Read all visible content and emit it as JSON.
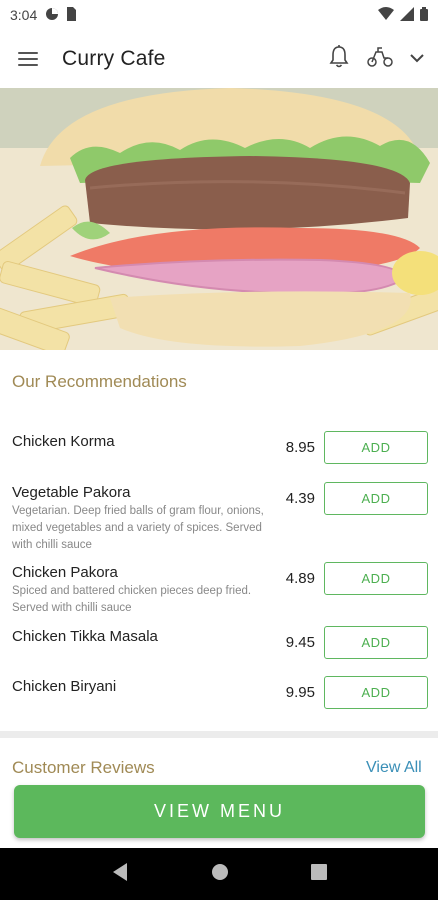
{
  "status": {
    "time": "3:04"
  },
  "app": {
    "title": "Curry Cafe"
  },
  "recommendations": {
    "title": "Our Recommendations",
    "items": [
      {
        "name": "Chicken Korma",
        "desc": "",
        "price": "8.95",
        "button": "ADD"
      },
      {
        "name": "Vegetable Pakora",
        "desc": "Vegetarian. Deep fried balls of gram flour, onions, mixed vegetables and a variety of spices. Served with chilli sauce",
        "price": "4.39",
        "button": "ADD"
      },
      {
        "name": "Chicken Pakora",
        "desc": "Spiced and battered chicken pieces deep fried. Served with chilli sauce",
        "price": "4.89",
        "button": "ADD"
      },
      {
        "name": "Chicken Tikka Masala",
        "desc": "",
        "price": "9.45",
        "button": "ADD"
      },
      {
        "name": "Chicken Biryani",
        "desc": "",
        "price": "9.95",
        "button": "ADD"
      }
    ]
  },
  "reviews": {
    "title": "Customer Reviews",
    "view_all": "View All"
  },
  "cta": {
    "label": "VIEW MENU"
  },
  "colors": {
    "accent_green": "#5cb85c",
    "section_gold": "#a08a55",
    "link_blue": "#3a8fb7"
  },
  "icons": [
    "menu-icon",
    "bell-icon",
    "scooter-icon",
    "chevron-down-icon",
    "back-icon",
    "home-icon",
    "recents-icon"
  ]
}
